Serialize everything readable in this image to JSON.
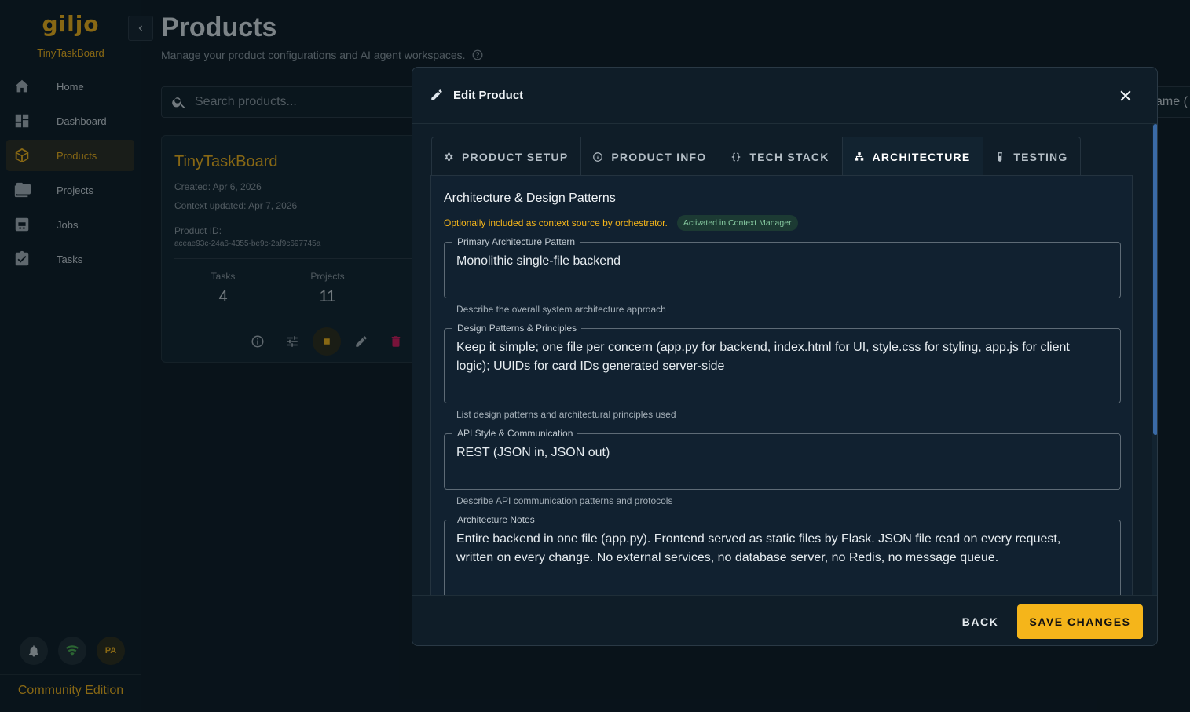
{
  "sidebar": {
    "logo": "giljo",
    "org_name": "TinyTaskBoard",
    "items": [
      {
        "label": "Home",
        "icon": "home-icon",
        "active": false
      },
      {
        "label": "Dashboard",
        "icon": "dashboard-icon",
        "active": false
      },
      {
        "label": "Products",
        "icon": "products-icon",
        "active": true
      },
      {
        "label": "Projects",
        "icon": "folder-icon",
        "active": false
      },
      {
        "label": "Jobs",
        "icon": "jobs-icon",
        "active": false
      },
      {
        "label": "Tasks",
        "icon": "tasks-icon",
        "active": false
      }
    ],
    "avatar_initials": "PA",
    "edition": "Community Edition"
  },
  "header": {
    "title": "Products",
    "subtitle": "Manage your product configurations and AI agent workspaces."
  },
  "search": {
    "placeholder": "Search products..."
  },
  "sort_partial": "ame (",
  "product_card": {
    "name": "TinyTaskBoard",
    "created": "Created: Apr 6, 2026",
    "context_updated": "Context updated: Apr 7, 2026",
    "product_id_label": "Product ID:",
    "product_id": "aceae93c-24a6-4355-be9c-2af9c697745a",
    "stats": [
      {
        "label": "Tasks",
        "value": "4"
      },
      {
        "label": "Projects",
        "value": "11"
      }
    ]
  },
  "dialog": {
    "title": "Edit Product",
    "tabs": [
      {
        "label": "PRODUCT SETUP",
        "icon": "gear-icon",
        "active": false
      },
      {
        "label": "PRODUCT INFO",
        "icon": "info-icon",
        "active": false
      },
      {
        "label": "TECH STACK",
        "icon": "braces-icon",
        "active": false
      },
      {
        "label": "ARCHITECTURE",
        "icon": "sitemap-icon",
        "active": true
      },
      {
        "label": "TESTING",
        "icon": "test-tube-icon",
        "active": false
      }
    ],
    "section_title": "Architecture & Design Patterns",
    "section_note": "Optionally included as context source by orchestrator.",
    "section_chip": "Activated in Context Manager",
    "fields": [
      {
        "label": "Primary Architecture Pattern",
        "value": "Monolithic single-file backend",
        "hint": "Describe the overall system architecture approach"
      },
      {
        "label": "Design Patterns & Principles",
        "value": "Keep it simple; one file per concern (app.py for backend, index.html for UI, style.css for styling, app.js for client logic); UUIDs for card IDs generated server-side",
        "hint": "List design patterns and architectural principles used"
      },
      {
        "label": "API Style & Communication",
        "value": "REST (JSON in, JSON out)",
        "hint": "Describe API communication patterns and protocols"
      },
      {
        "label": "Architecture Notes",
        "value": "Entire backend in one file (app.py). Frontend served as static files by Flask. JSON file read on every request, written on every change. No external services, no database server, no Redis, no message queue."
      }
    ],
    "back_label": "BACK",
    "save_label": "SAVE CHANGES"
  },
  "colors": {
    "accent": "#f5b51a",
    "background": "#0d1b26",
    "chip_bg": "#1c3a33",
    "chip_text": "#86c9a0",
    "delete": "#d81b60"
  }
}
